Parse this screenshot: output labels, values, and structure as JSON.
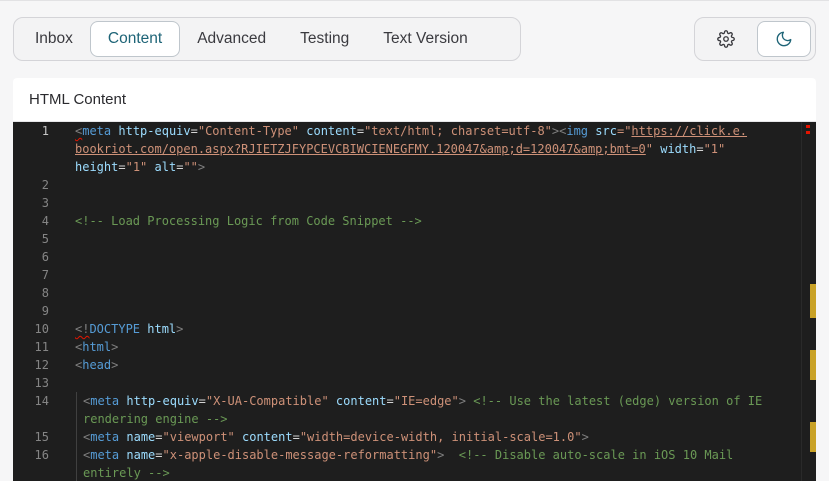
{
  "tabs": [
    {
      "label": "Inbox",
      "active": false
    },
    {
      "label": "Content",
      "active": true
    },
    {
      "label": "Advanced",
      "active": false
    },
    {
      "label": "Testing",
      "active": false
    },
    {
      "label": "Text Version",
      "active": false
    }
  ],
  "tools": {
    "settings_icon": "gear-icon",
    "theme_icon": "moon-icon"
  },
  "panel": {
    "title": "HTML Content"
  },
  "editor": {
    "line_numbers": [
      "1",
      "2",
      "3",
      "4",
      "5",
      "6",
      "7",
      "8",
      "9",
      "10",
      "11",
      "12",
      "13",
      "14",
      "15",
      "16"
    ],
    "current_line": "1",
    "code": {
      "l1a_open": "<",
      "l1a_tag": "meta",
      "l1a_attr1": "http-equiv",
      "l1a_eq1": "=",
      "l1a_val1": "\"Content-Type\"",
      "l1a_attr2": "content",
      "l1a_eq2": "=",
      "l1a_val2": "\"text/html; charset=utf-8\"",
      "l1a_close": "><",
      "l1a_tag2": "img",
      "l1a_attr3": "src",
      "l1a_eq3": "=\"",
      "l1a_url": "https://click.e.",
      "l1b_url": "bookriot.com/open.aspx?RJIETZJFYPCEVCBIWCIENEGFMY.120047&amp;d=120047&amp;bmt=0",
      "l1b_quote": "\"",
      "l1b_attr": "width",
      "l1b_eq": "=",
      "l1b_val": "\"1\"",
      "l1c_attr1": "height",
      "l1c_eq1": "=",
      "l1c_val1": "\"1\"",
      "l1c_attr2": "alt",
      "l1c_eq2": "=",
      "l1c_val2": "\"\"",
      "l1c_close": ">",
      "l4_comment": "<!-- Load Processing Logic from Code Snippet -->",
      "l10_open": "<!",
      "l10_tag": "DOCTYPE",
      "l10_rest": " html",
      "l10_close": ">",
      "l11_open": "<",
      "l11_tag": "html",
      "l11_close": ">",
      "l12_open": "<",
      "l12_tag": "head",
      "l12_close": ">",
      "l14a_open": "<",
      "l14a_tag": "meta",
      "l14a_attr1": "http-equiv",
      "l14a_eq1": "=",
      "l14a_val1": "\"X-UA-Compatible\"",
      "l14a_attr2": "content",
      "l14a_eq2": "=",
      "l14a_val2": "\"IE=edge\"",
      "l14a_close": ">",
      "l14a_comment": "<!-- Use the latest (edge) version of IE",
      "l14b_comment": "rendering engine -->",
      "l15_open": "<",
      "l15_tag": "meta",
      "l15_attr1": "name",
      "l15_eq1": "=",
      "l15_val1": "\"viewport\"",
      "l15_attr2": "content",
      "l15_eq2": "=",
      "l15_val2": "\"width=device-width, initial-scale=1.0\"",
      "l15_close": ">",
      "l16a_open": "<",
      "l16a_tag": "meta",
      "l16a_attr1": "name",
      "l16a_eq1": "=",
      "l16a_val1": "\"x-apple-disable-message-reformatting\"",
      "l16a_close": ">",
      "l16a_comment": "<!-- Disable auto-scale in iOS 10 Mail",
      "l16b_comment": "entirely -->"
    }
  },
  "colors": {
    "accent": "#1e6477",
    "editor_bg": "#1e1e1e",
    "marker": "#c9a227",
    "error": "#e51400"
  }
}
